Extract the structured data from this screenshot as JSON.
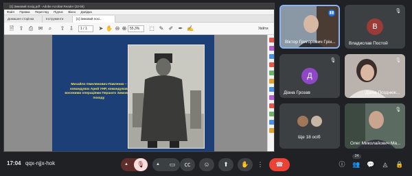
{
  "pdf_window": {
    "title": "[1] Зимовий похід.pdf - Adobe Acrobat Reader (32-bit)",
    "menu": [
      "Файл",
      "Правка",
      "Перегляд",
      "Підпис",
      "Вікно",
      "Довідка"
    ],
    "tabs": [
      "Домашня сторінка",
      "Інструменти",
      "[1] Зимовий похі..."
    ],
    "page_current": "1",
    "page_total": "/ 1",
    "zoom": "55,3%",
    "share_label": "Увійти"
  },
  "slide": {
    "caption": "Михайло Омелянович-Павленко – командувач Армії УНР, командував воєнними операціями Першого Зимового походу"
  },
  "participants": [
    {
      "name": "Віктор Григорович Грін...",
      "type": "video",
      "speaking": true
    },
    {
      "name": "Владислав Постой",
      "type": "avatar",
      "initial": "В",
      "avatar_color": "#9a3b38"
    },
    {
      "name": "Діана Грозав",
      "type": "avatar",
      "initial": "Д",
      "avatar_color": "#8e47c5"
    },
    {
      "name": "Діана Позднюк...",
      "type": "video"
    },
    {
      "name": "Ще 18 осіб",
      "type": "group"
    },
    {
      "name": "Олег Миколайович Ма...",
      "type": "video"
    }
  ],
  "footer": {
    "time": "17:04",
    "meeting_code": "qqx-njjx-hok",
    "people_count": "24"
  },
  "icons": {
    "mic_off": "mic-off-icon",
    "camera": "camera-icon",
    "captions": "captions-icon",
    "emoji": "emoji-icon",
    "present": "present-icon",
    "raise_hand": "raise-hand-icon",
    "more": "more-icon",
    "hangup": "hangup-icon",
    "info": "info-icon",
    "people": "people-icon",
    "chat": "chat-icon",
    "activities": "activities-icon",
    "lock": "lock-icon"
  },
  "colors": {
    "meet_bg": "#202124",
    "tile_bg": "#3c4043",
    "hangup": "#ea4335",
    "speaking": "#8ab4f8",
    "slide_bg": "#1d3f78",
    "caption": "#ffe94a"
  }
}
